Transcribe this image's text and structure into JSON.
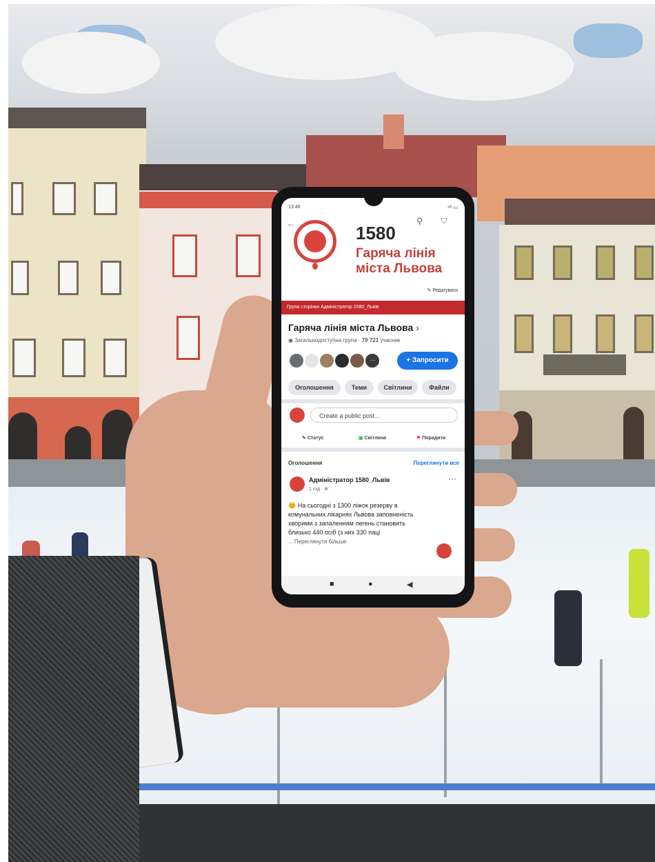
{
  "phone": {
    "status_time": "13:46",
    "status_icons": "⁴ᴳ ▭",
    "page_number": "1580",
    "page_title_line1": "Гаряча лінія",
    "page_title_line2": "міста Львова",
    "edit_label": "Редагувати",
    "ribbon_text": "Група сторінки Адміністратор 1580_Львів",
    "group_name": "Гаряча лінія міста Львова",
    "group_name_chevron": "›",
    "group_type": "Загальнодоступна група",
    "member_separator": "·",
    "member_count": "79 721",
    "member_label": "учасник",
    "avatar_more": "···",
    "invite_label": "+ Запросити",
    "tabs": [
      "Оголошення",
      "Теми",
      "Світлини",
      "Файли"
    ],
    "composer_placeholder": "Create a public post...",
    "actions": [
      {
        "label": "Статус",
        "color": "#4a5bd4",
        "icon": "status-icon"
      },
      {
        "label": "Світлина",
        "color": "#45bd62",
        "icon": "photo-icon"
      },
      {
        "label": "Порадити",
        "color": "#f02849",
        "icon": "recommend-icon"
      }
    ],
    "section_title": "Оголошення",
    "see_all": "Переглянути все",
    "post": {
      "author": "Адміністратор 1580_Львів",
      "time": "1 год · ⊕",
      "more": "···",
      "text": "😊 На сьогодні з 1300 ліжок резерву в комунальних лікарнях Львова заповненість хворими з запаленням легень становить близько 440 осіб (з них 330 паці",
      "see_more": "... Переглянути більше"
    },
    "nav_buttons": [
      "■",
      "●",
      "◀"
    ],
    "accent_color": "#c3292d",
    "button_color": "#1b74e4"
  }
}
